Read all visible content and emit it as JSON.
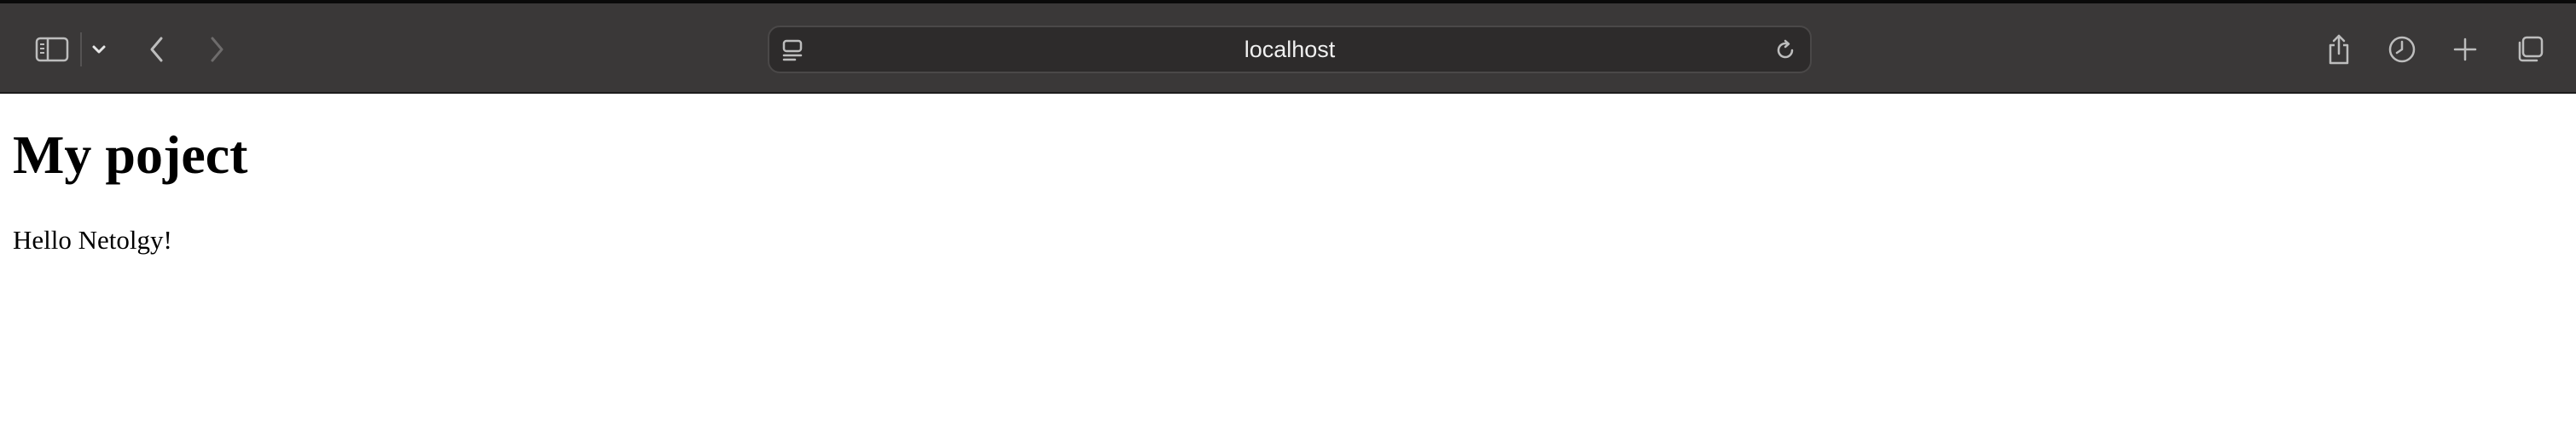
{
  "browser": {
    "address_bar": {
      "url": "localhost"
    },
    "toolbar": {
      "left_icons": [
        "sidebar-icon",
        "chevron-down-icon",
        "back-icon",
        "forward-icon"
      ],
      "address_icons": [
        "page-menu-icon",
        "reload-icon"
      ],
      "right_icons": [
        "share-icon",
        "history-icon",
        "new-tab-icon",
        "tab-overview-icon"
      ],
      "forward_enabled": false
    },
    "colors": {
      "toolbar_bg": "#3a3838",
      "address_bg": "#2d2b2b",
      "icon": "#bdbdbd",
      "icon_disabled": "#6e6c6c",
      "address_text": "#f0f0f0",
      "page_bg": "#ffffff",
      "page_text": "#000000"
    }
  },
  "page": {
    "heading": "My poject",
    "paragraph": "Hello Netolgy!"
  }
}
